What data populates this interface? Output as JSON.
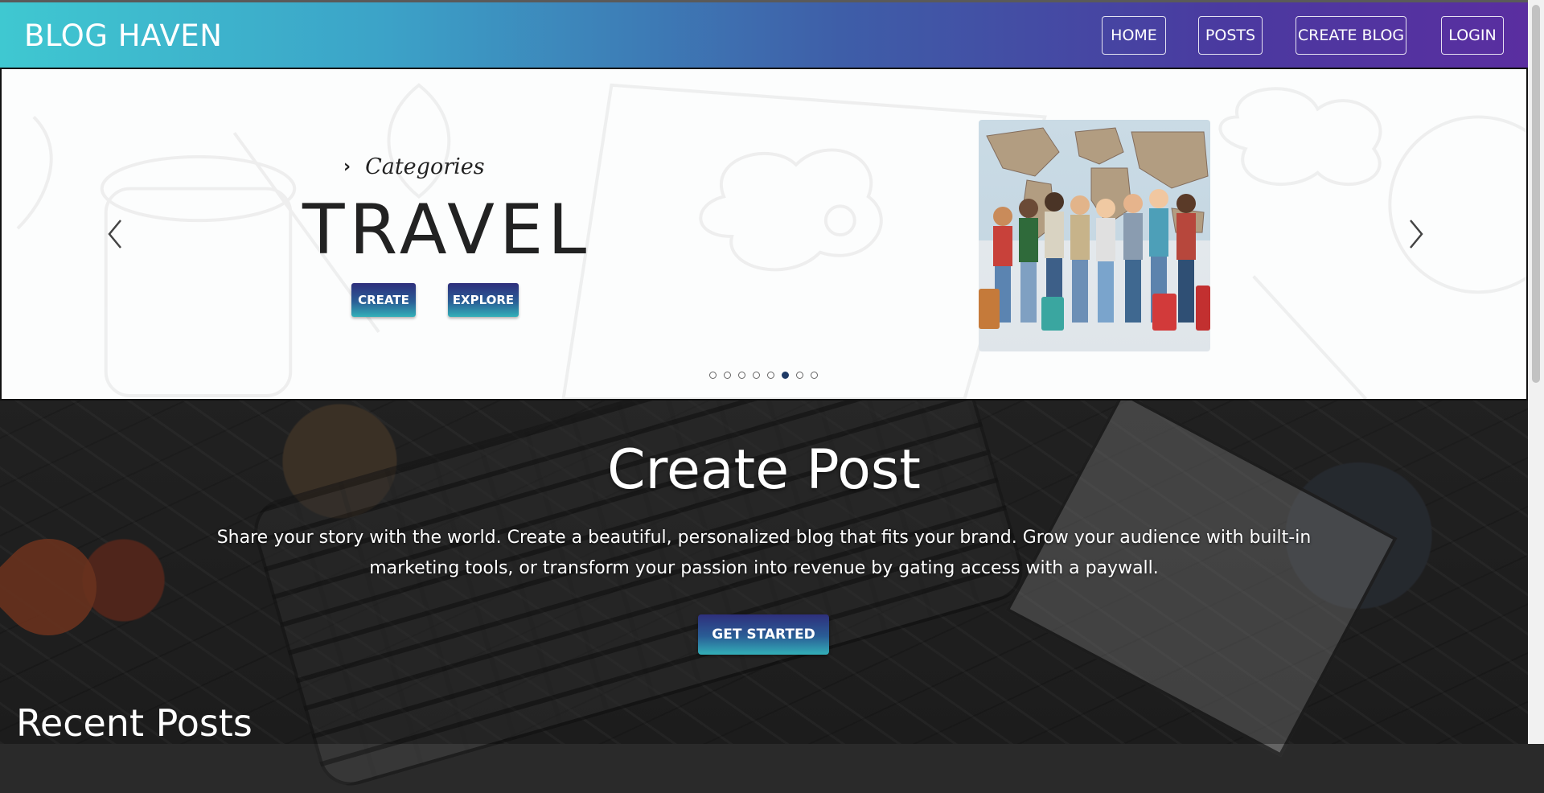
{
  "navbar": {
    "brand": "BLOG HAVEN",
    "links": [
      "HOME",
      "POSTS",
      "CREATE BLOG",
      "LOGIN"
    ]
  },
  "carousel": {
    "category_label": "Categories",
    "category_title": "TRAVEL",
    "buttons": {
      "create": "CREATE",
      "explore": "EXPLORE"
    },
    "indicator_count": 8,
    "active_index": 5
  },
  "hero": {
    "title": "Create Post",
    "description": "Share your story with the world. Create a beautiful, personalized blog that fits your brand. Grow your audience with built-in marketing tools, or transform your passion into revenue by gating access with a paywall.",
    "cta": "GET STARTED"
  },
  "recent": {
    "heading": "Recent Posts"
  },
  "colors": {
    "nav_gradient_start": "#3fc8d1",
    "nav_gradient_end": "#5a2ea0",
    "button_gradient_top": "#2e2f7c",
    "button_gradient_bottom": "#33b0b8",
    "indicator_active": "#1e3a66"
  },
  "icons": {
    "prev": "chevron-left-icon",
    "next": "chevron-right-icon",
    "category": "chevron-right-icon"
  }
}
